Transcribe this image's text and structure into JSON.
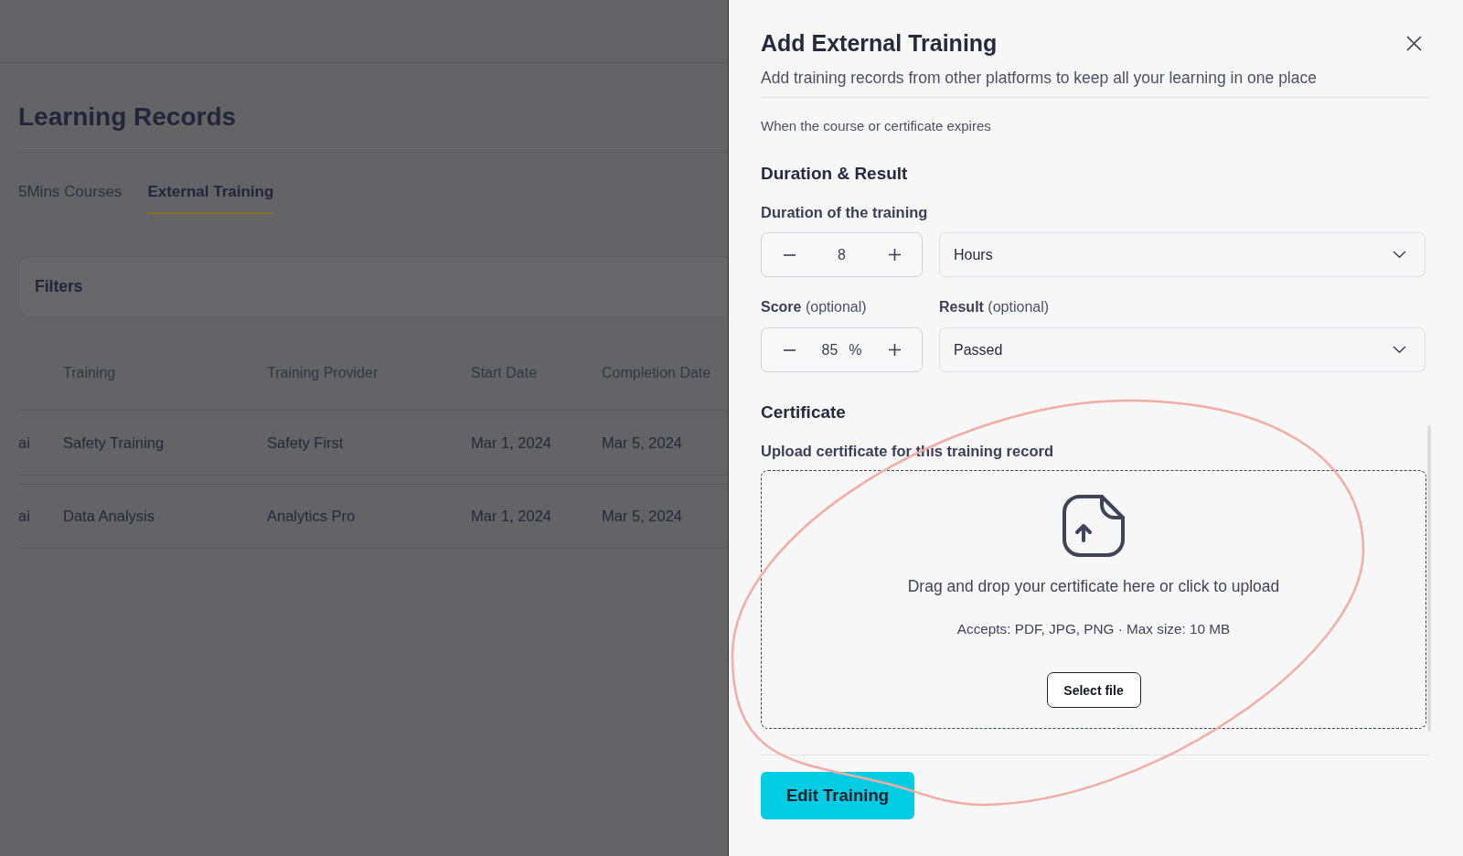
{
  "page": {
    "title": "Learning Records",
    "tabs": [
      {
        "label": "5Mins Courses",
        "selected": false
      },
      {
        "label": "External Training",
        "selected": true
      }
    ],
    "filters": {
      "title": "Filters"
    },
    "table": {
      "columns": [
        "Training",
        "Training Provider",
        "Start Date",
        "Completion Date"
      ],
      "rows": [
        {
          "column_1": "ai",
          "cells": [
            "Safety Training",
            "Safety First",
            "Mar 1, 2024",
            "Mar 5, 2024"
          ]
        },
        {
          "column_1": "ai",
          "cells": [
            "Data Analysis",
            "Analytics Pro",
            "Mar 1, 2024",
            "Mar 5, 2024"
          ]
        }
      ]
    }
  },
  "panel": {
    "title": "Add External Training",
    "subtitle": "Add training records from other platforms to keep all your learning in one place",
    "expiry_hint": "When the course or certificate expires",
    "duration_result": {
      "heading": "Duration & Result",
      "duration": {
        "label": "Duration of the training",
        "value": "8",
        "unit": "Hours"
      },
      "score": {
        "label": "**Score** (optional)",
        "value": "85",
        "suffix": "%"
      },
      "result": {
        "label": "**Result** (optional)",
        "value": "Passed"
      }
    },
    "certificate": {
      "heading": "Certificate",
      "label": "Upload certificate for this training record",
      "dropzone": {
        "prompt": "Drag and drop your certificate here or click to upload",
        "accepts": "Accepts: PDF, JPG, PNG · Max size: 10 MB",
        "button": "Select file"
      }
    },
    "submit_button": "Edit Training"
  },
  "annotation": {
    "kind": "ellipse"
  }
}
